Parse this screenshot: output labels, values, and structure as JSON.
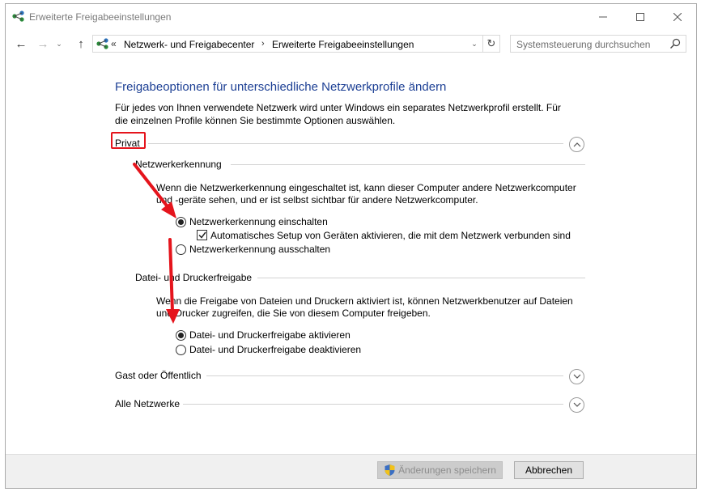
{
  "window": {
    "title": "Erweiterte Freigabeeinstellungen",
    "app_icon": "network-icon",
    "controls": {
      "minimize": "minimize-icon",
      "maximize": "maximize-icon",
      "close": "close-icon"
    }
  },
  "nav": {
    "back": "←",
    "forward": "→",
    "recent": "⌄",
    "up": "↑"
  },
  "address": {
    "overflow": "«",
    "crumbs": [
      "Netzwerk- und Freigabecenter",
      "Erweiterte Freigabeeinstellungen"
    ],
    "crumb_arrow": "›",
    "dropdown": "⌄",
    "refresh": "↻"
  },
  "search": {
    "placeholder": "Systemsteuerung durchsuchen"
  },
  "main": {
    "heading": "Freigabeoptionen für unterschiedliche Netzwerkprofile ändern",
    "description": "Für jedes von Ihnen verwendete Netzwerk wird unter Windows ein separates Netzwerkprofil erstellt. Für die einzelnen Profile können Sie bestimmte Optionen auswählen."
  },
  "profiles": {
    "privat": {
      "label": "Privat",
      "state": "expanded",
      "discovery": {
        "title": "Netzwerkerkennung",
        "text": "Wenn die Netzwerkerkennung eingeschaltet ist, kann dieser Computer andere Netzwerkcomputer und -geräte sehen, und er ist selbst sichtbar für andere Netzwerkcomputer.",
        "option_on": "Netzwerkerkennung einschalten",
        "option_on_checked": true,
        "auto_setup": "Automatisches Setup von Geräten aktivieren, die mit dem Netzwerk verbunden sind",
        "auto_setup_checked": true,
        "option_off": "Netzwerkerkennung ausschalten",
        "option_off_checked": false
      },
      "sharing": {
        "title": "Datei- und Druckerfreigabe",
        "text": "Wenn die Freigabe von Dateien und Druckern aktiviert ist, können Netzwerkbenutzer auf Dateien und Drucker zugreifen, die Sie von diesem Computer freigeben.",
        "option_on": "Datei- und Druckerfreigabe aktivieren",
        "option_on_checked": true,
        "option_off": "Datei- und Druckerfreigabe deaktivieren",
        "option_off_checked": false
      }
    },
    "guest": {
      "label": "Gast oder Öffentlich",
      "state": "collapsed"
    },
    "all": {
      "label": "Alle Netzwerke",
      "state": "collapsed"
    }
  },
  "footer": {
    "save_label": "Änderungen speichern",
    "save_enabled": false,
    "cancel_label": "Abbrechen"
  },
  "colors": {
    "heading": "#1c3f94",
    "annotation": "#e5141c"
  }
}
